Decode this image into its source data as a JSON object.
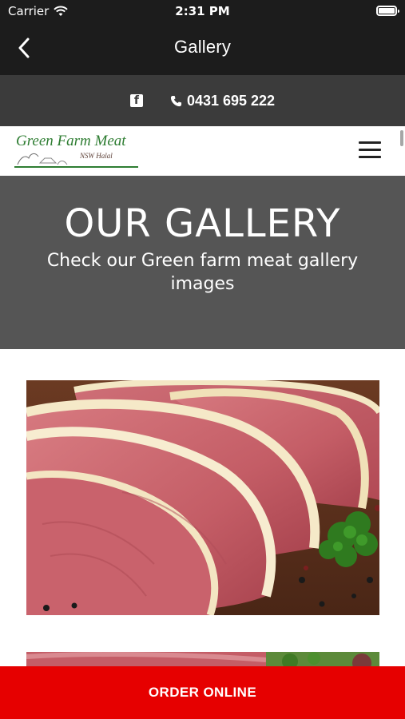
{
  "status_bar": {
    "carrier": "Carrier",
    "time": "2:31 PM"
  },
  "nav": {
    "title": "Gallery"
  },
  "contact": {
    "phone": "0431 695 222",
    "facebook_icon": "facebook-icon",
    "phone_icon": "phone-icon"
  },
  "logo": {
    "text": "Green Farm Meat",
    "subtext": "NSW Halal"
  },
  "hero": {
    "title": "OUR GALLERY",
    "subtitle": "Check our Green farm meat gallery images"
  },
  "order_button": {
    "label": "ORDER ONLINE"
  },
  "colors": {
    "header_dark": "#1c1c1c",
    "contact_bar": "#3b3b3b",
    "hero_bg": "#555555",
    "order_red": "#e60000",
    "logo_green": "#2e7d32"
  }
}
